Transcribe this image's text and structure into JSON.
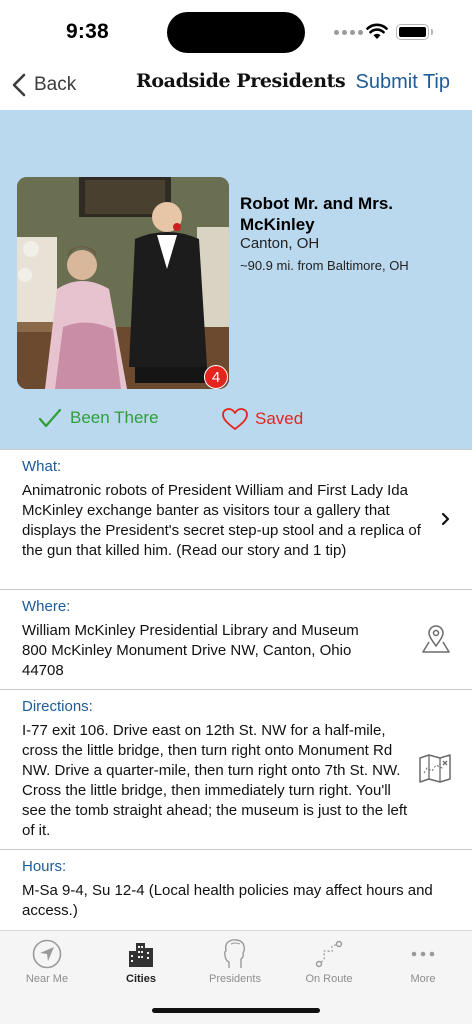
{
  "status": {
    "time": "9:38"
  },
  "nav": {
    "back_label": "Back",
    "brand": "Roadside Presidents",
    "submit_label": "Submit Tip"
  },
  "place": {
    "name": "Robot Mr. and Mrs. McKinley",
    "city": "Canton, OH",
    "distance": "~90.9 mi. from Baltimore, OH",
    "photo_count": "4",
    "been_there_label": "Been There",
    "saved_label": "Saved"
  },
  "sections": {
    "what": {
      "heading": "What:",
      "text": "Animatronic robots of President William and First Lady Ida McKinley exchange banter as visitors tour a gallery that displays the President's secret step-up stool and a replica of the gun that killed him. (Read our story and 1 tip)"
    },
    "where": {
      "heading": "Where:",
      "line1": "William McKinley Presidential Library and Museum",
      "line2": "800 McKinley Monument Drive NW, Canton, Ohio  44708"
    },
    "directions": {
      "heading": "Directions:",
      "text": "I-77 exit 106. Drive east on 12th St. NW for a half-mile, cross the little bridge, then turn right onto Monument Rd NW. Drive a quarter-mile, then turn right onto 7th St. NW. Cross the little bridge, then immediately turn right. You'll see the tomb straight ahead; the museum is just to the left of it."
    },
    "hours": {
      "heading": "Hours:",
      "text": "M-Sa 9-4, Su 12-4 (Local health policies may affect hours and access.)"
    }
  },
  "tabs": [
    {
      "label": "Near Me",
      "icon": "compass-icon"
    },
    {
      "label": "Cities",
      "icon": "city-icon",
      "active": true
    },
    {
      "label": "Presidents",
      "icon": "president-profile-icon"
    },
    {
      "label": "On Route",
      "icon": "route-icon"
    },
    {
      "label": "More",
      "icon": "ellipsis-icon"
    }
  ],
  "colors": {
    "accent": "#1d5c97",
    "hero_bg": "#bad9ee",
    "been_there": "#2f9e39",
    "saved": "#e5241d"
  }
}
